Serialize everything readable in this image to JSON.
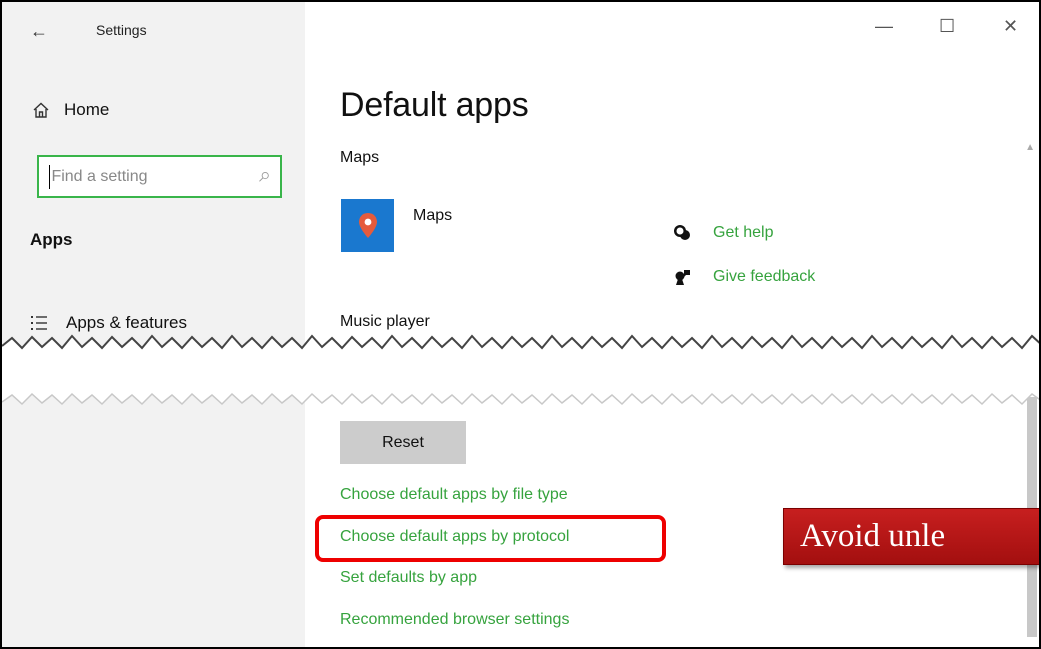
{
  "window": {
    "title": "Settings",
    "controls": {
      "minimize": "—",
      "maximize": "☐",
      "close": "✕"
    }
  },
  "sidebar": {
    "home_label": "Home",
    "search": {
      "placeholder": "Find a setting"
    },
    "section_heading": "Apps",
    "items": [
      {
        "label": "Apps & features",
        "icon": "list-icon"
      }
    ]
  },
  "main": {
    "title": "Default apps",
    "maps": {
      "section_label": "Maps",
      "app_name": "Maps"
    },
    "help_links": [
      {
        "label": "Get help",
        "icon": "help-chat-icon"
      },
      {
        "label": "Give feedback",
        "icon": "feedback-icon"
      }
    ],
    "music": {
      "section_label": "Music player"
    },
    "reset_label": "Reset",
    "links": [
      "Choose default apps by file type",
      "Choose default apps by protocol",
      "Set defaults by app",
      "Recommended browser settings"
    ]
  },
  "annotation": {
    "callout_text": "Avoid unle"
  },
  "colors": {
    "sidebar_bg": "#f2f2f2",
    "link_green": "#36a33e",
    "search_border": "#39b54a",
    "maps_tile": "#1a78cf",
    "highlight": "#e00000",
    "callout_bg": "#b51717"
  }
}
